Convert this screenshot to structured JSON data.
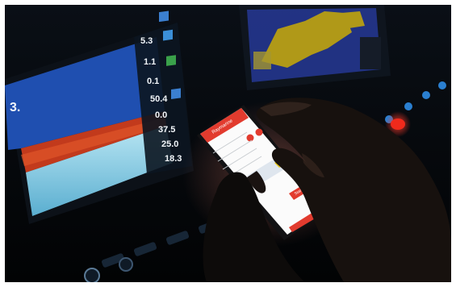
{
  "sonar_screen": {
    "readouts": [
      "5.3",
      "1.1",
      "0.1",
      "50.4",
      "0.0",
      "37.5",
      "25.0",
      "18.3"
    ],
    "depth_label": "3.",
    "colors": {
      "water": "#1f4fb0",
      "seabed": "#c23a1c",
      "bottom": "#8fd3e8"
    }
  },
  "chart_plotter": {
    "colors": {
      "land": "#e8c81a",
      "sea": "#2a3fa8"
    }
  },
  "phone": {
    "app_color": "#e23b2e",
    "header_title": "Raymarine",
    "action_label": "Start"
  },
  "console": {
    "button_icons": [
      "circle-button-icon",
      "circle-button-icon",
      "circle-button-icon",
      "red-power-button-icon"
    ]
  }
}
